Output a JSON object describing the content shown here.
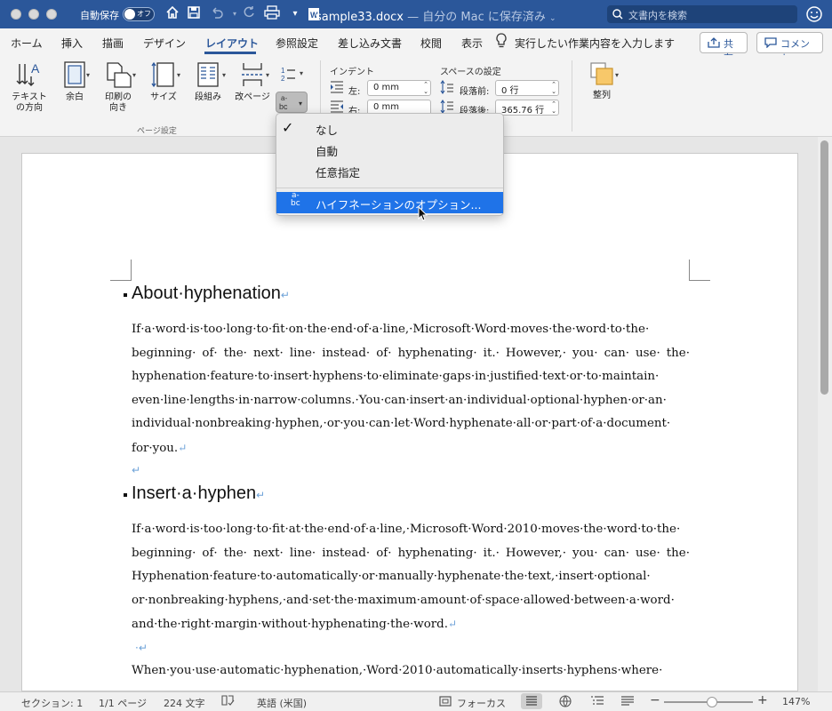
{
  "titlebar": {
    "autosave_label": "自動保存",
    "toggle_state": "オフ",
    "file_name": "sample33.docx",
    "location": "— 自分の Mac に保存済み",
    "search_placeholder": "文書内を検索"
  },
  "tabs": [
    "ホーム",
    "挿入",
    "描画",
    "デザイン",
    "レイアウト",
    "参照設定",
    "差し込み文書",
    "校閲",
    "表示"
  ],
  "active_tab": "レイアウト",
  "tell_me": "実行したい作業内容を入力します",
  "share_label": "共有",
  "comment_label": "コメント",
  "ribbon": {
    "text_direction": "テキスト\nの方向",
    "margins": "余白",
    "orientation": "印刷の\n向き",
    "size": "サイズ",
    "columns": "段組み",
    "breaks": "改ページ",
    "page_setup_group": "ページ設定",
    "indent_title": "インデント",
    "indent_left_label": "左:",
    "indent_left_value": "0 mm",
    "indent_right_label": "右:",
    "indent_right_value": "0 mm",
    "spacing_title": "スペースの設定",
    "spacing_before_label": "段落前:",
    "spacing_before_value": "0 行",
    "spacing_after_label": "段落後:",
    "spacing_after_value": "365.76 行",
    "arrange": "整列"
  },
  "menu": {
    "items": [
      "なし",
      "自動",
      "任意指定"
    ],
    "checked_index": 0,
    "options_label": "ハイフネーションのオプション..."
  },
  "document": {
    "heading1": "About·hyphenation",
    "para1": "If·a·word·is·too·long·to·fit·on·the·end·of·a·line,·Microsoft·Word·moves·the·word·to·the· beginning· of· the· next· line· instead· of· hyphenating· it.· However,· you· can· use· the· hyphenation·feature·to·insert·hyphens·to·eliminate·gaps·in·justified·text·or·to·maintain· even·line·lengths·in·narrow·columns.·You·can·insert·an·individual·optional·hyphen·or·an· individual·nonbreaking·hyphen,·or·you·can·let·Word·hyphenate·all·or·part·of·a·document· for·you.",
    "heading2": "Insert·a·hyphen",
    "para2": "If·a·word·is·too·long·to·fit·at·the·end·of·a·line,·Microsoft·Word·2010·moves·the·word·to·the· beginning· of· the· next· line· instead· of· hyphenating· it.· However,· you· can· use· the· Hyphenation·feature·to·automatically·or·manually·hyphenate·the·text,·insert·optional· or·nonbreaking·hyphens,·and·set·the·maximum·amount·of·space·allowed·between·a·word· and·the·right·margin·without·hyphenating·the·word.",
    "para3": "When·you·use·automatic·hyphenation,·Word·2010·automatically·inserts·hyphens·where·"
  },
  "statusbar": {
    "section": "セクション: 1",
    "page": "1/1 ページ",
    "words": "224 文字",
    "language": "英語 (米国)",
    "focus": "フォーカス",
    "zoom": "147%"
  }
}
